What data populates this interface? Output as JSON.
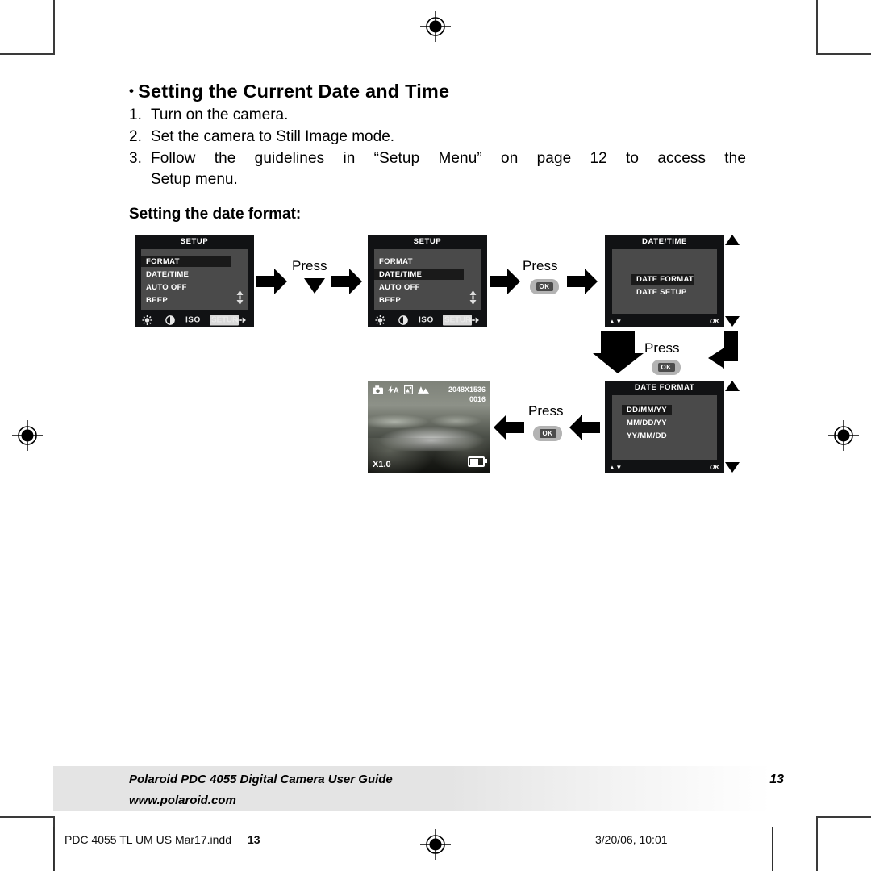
{
  "page": {
    "heading": "Setting the Current Date and Time",
    "heading_bullet": "•",
    "steps": [
      {
        "num": "1.",
        "text": "Turn on the camera."
      },
      {
        "num": "2.",
        "text": "Set the camera to Still Image mode."
      },
      {
        "num": "3.",
        "text": "Follow the guidelines in “Setup Menu” on page 12 to access the",
        "cont": "Setup menu."
      }
    ],
    "subheading": "Setting the date format:"
  },
  "diagram": {
    "screen1": {
      "title": "SETUP",
      "items": [
        "FORMAT",
        "DATE/TIME",
        "AUTO OFF",
        "BEEP"
      ],
      "selected": "FORMAT",
      "statusbar": [
        "wb-icon",
        "contrast-icon",
        "ISO",
        "SETUP",
        "leftright-icon"
      ],
      "setup_chip": "SETUP",
      "iso_label": "ISO"
    },
    "screen2": {
      "title": "SETUP",
      "items": [
        "FORMAT",
        "DATE/TIME",
        "AUTO OFF",
        "BEEP"
      ],
      "selected": "DATE/TIME",
      "setup_chip": "SETUP",
      "iso_label": "ISO"
    },
    "screen3": {
      "title": "DATE/TIME",
      "items": [
        "DATE FORMAT",
        "DATE SETUP"
      ],
      "selected": "DATE FORMAT",
      "hint_left": "▲▼",
      "hint_right": "OK"
    },
    "screen4": {
      "title": "DATE FORMAT",
      "items": [
        "DD/MM/YY",
        "MM/DD/YY",
        "YY/MM/DD"
      ],
      "selected": "DD/MM/YY",
      "hint_left": "▲▼",
      "hint_right": "OK"
    },
    "preview": {
      "icons": [
        "camera-icon",
        "flash-auto-icon",
        "image-quality-icon",
        "landscape-icon"
      ],
      "flash_label": "A",
      "resolution": "2048X1536",
      "shots_remaining": "0016",
      "zoom": "X1.0",
      "battery": "battery-icon"
    },
    "press_labels": [
      "Press",
      "Press",
      "Press",
      "Press"
    ],
    "ok_key": "OK",
    "down_key": "▼"
  },
  "footer": {
    "guide_title": "Polaroid PDC 4055 Digital Camera User Guide",
    "website": "www.polaroid.com",
    "page_number": "13"
  },
  "printbar": {
    "filename": "PDC 4055 TL UM US Mar17.indd",
    "overlap_page": "13",
    "timestamp": "3/20/06, 10:01",
    "registration": "registration-mark"
  }
}
